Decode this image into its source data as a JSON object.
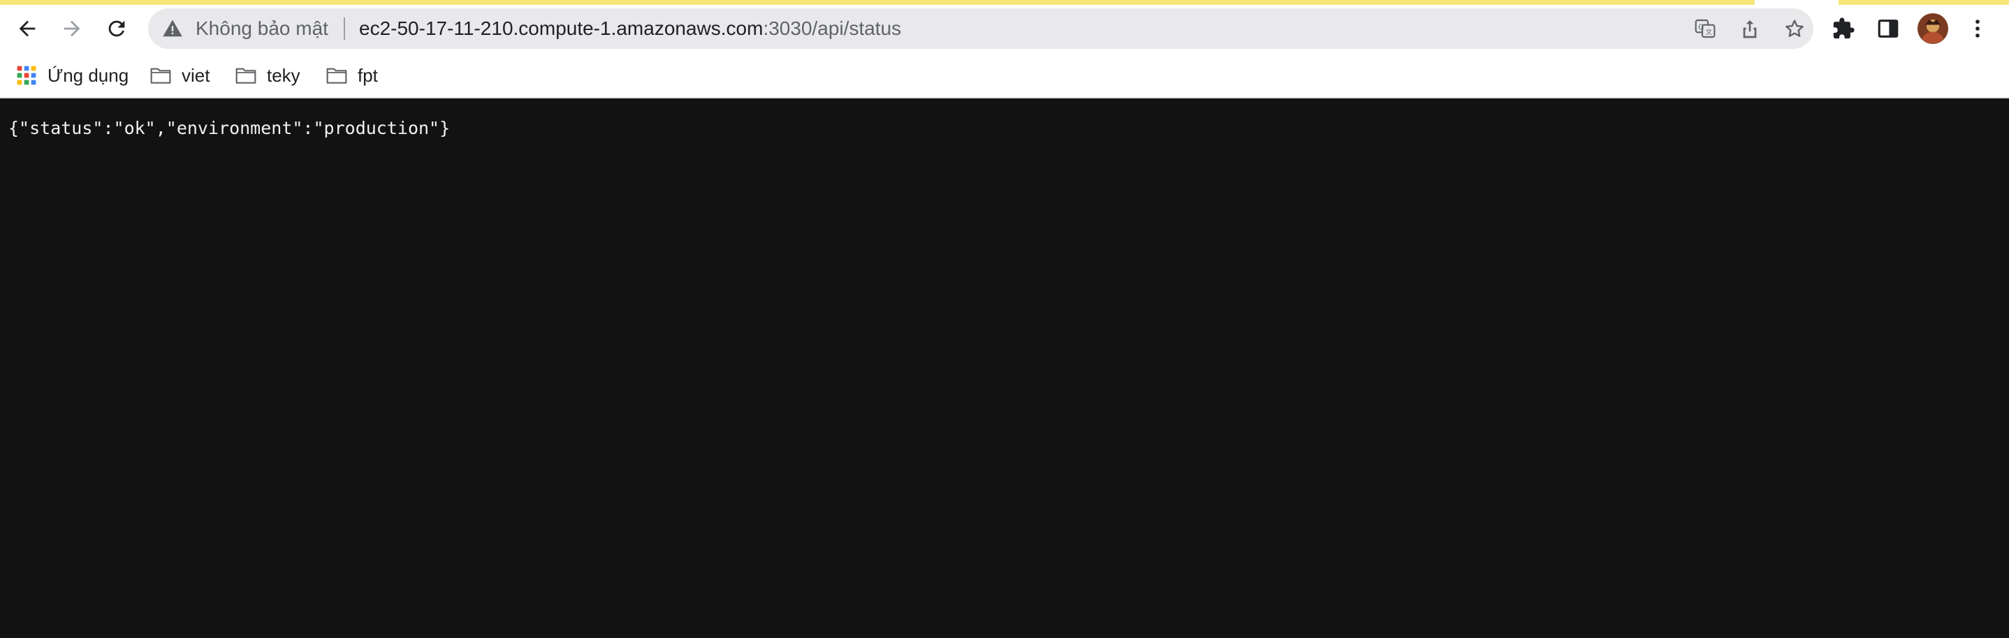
{
  "browser": {
    "security_label": "Không bảo mật",
    "url_host": "ec2-50-17-11-210.compute-1.amazonaws.com",
    "url_path": ":3030/api/status",
    "toolbar_icons": [
      "back-arrow-icon",
      "forward-arrow-icon",
      "reload-icon",
      "warning-icon",
      "translate-icon",
      "share-icon",
      "star-icon",
      "extensions-puzzle-icon",
      "side-panel-icon",
      "avatar",
      "kebab-menu-icon"
    ],
    "accent_color": "#f8e57b"
  },
  "bookmarks": {
    "apps_label": "Ứng dụng",
    "items": [
      {
        "label": "viet"
      },
      {
        "label": "teky"
      },
      {
        "label": "fpt"
      }
    ]
  },
  "page": {
    "body_text": "{\"status\":\"ok\",\"environment\":\"production\"}",
    "background": "#121212"
  }
}
